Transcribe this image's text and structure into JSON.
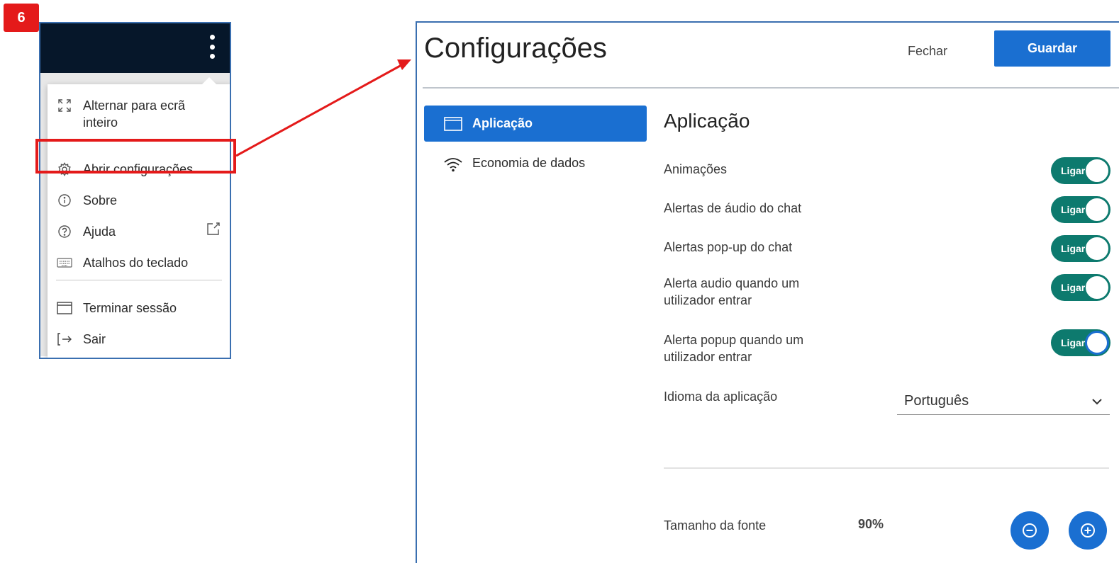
{
  "step_badge": "6",
  "menu": {
    "items": [
      {
        "label_line1": "Alternar para ecrã",
        "label_line2": "inteiro",
        "icon": "fullscreen-icon"
      },
      {
        "label": "Abrir configurações",
        "icon": "gear-icon"
      },
      {
        "label": "Sobre",
        "icon": "info-icon"
      },
      {
        "label": "Ajuda",
        "icon": "help-icon"
      },
      {
        "label": "Atalhos do teclado",
        "icon": "keyboard-icon"
      },
      {
        "label": "Terminar sessão",
        "icon": "window-icon"
      },
      {
        "label": "Sair",
        "icon": "exit-icon"
      }
    ]
  },
  "settings": {
    "title": "Configurações",
    "close_label": "Fechar",
    "save_label": "Guardar",
    "sidebar": [
      {
        "label": "Aplicação",
        "icon": "window-icon",
        "active": true
      },
      {
        "label": "Economia de dados",
        "icon": "wifi-icon",
        "active": false
      }
    ],
    "section_title": "Aplicação",
    "toggles": [
      {
        "label": "Animações",
        "state_text": "Ligar",
        "on": true
      },
      {
        "label": "Alertas de áudio do chat",
        "state_text": "Ligar",
        "on": true
      },
      {
        "label": "Alertas pop-up do chat",
        "state_text": "Ligar",
        "on": true
      },
      {
        "label_line1": "Alerta audio quando um",
        "label_line2": "utilizador entrar",
        "state_text": "Ligar",
        "on": true
      },
      {
        "label_line1": "Alerta popup quando um",
        "label_line2": "utilizador entrar",
        "state_text": "Ligar",
        "on": true
      }
    ],
    "language_label": "Idioma da aplicação",
    "language_value": "Português",
    "font_size_label": "Tamanho da fonte",
    "font_size_value": "90%"
  },
  "colors": {
    "accent": "#1a6fd1",
    "toggle_on": "#0d7a6e",
    "highlight": "#e41a1a",
    "menu_header": "#06172a"
  }
}
